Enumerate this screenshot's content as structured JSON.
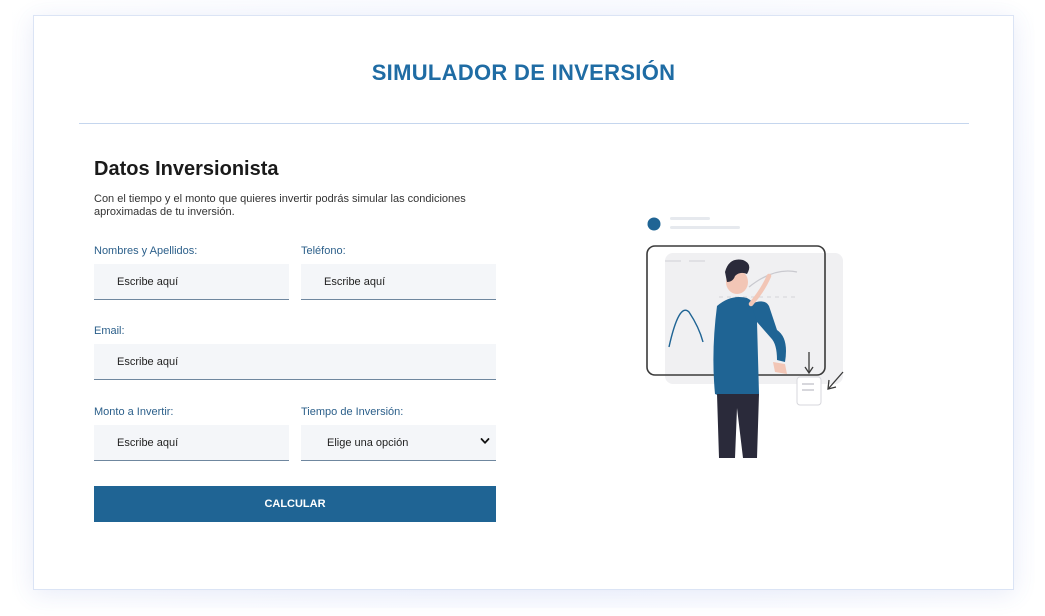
{
  "header": {
    "title": "SIMULADOR DE INVERSIÓN"
  },
  "form": {
    "section_title": "Datos Inversionista",
    "description": "Con el tiempo y el monto que quieres invertir podrás simular las condiciones aproximadas de tu inversión.",
    "fields": {
      "name": {
        "label": "Nombres y Apellidos:",
        "placeholder": "Escribe aquí"
      },
      "phone": {
        "label": "Teléfono:",
        "placeholder": "Escribe aquí"
      },
      "email": {
        "label": "Email:",
        "placeholder": "Escribe aquí"
      },
      "amount": {
        "label": "Monto a Invertir:",
        "placeholder": "Escribe aquí"
      },
      "term": {
        "label": "Tiempo de Inversión:",
        "selected": "Elige una opción"
      }
    },
    "submit_label": "CALCULAR"
  },
  "illustration": {
    "icon": "investor-chart-illustration"
  },
  "colors": {
    "accent": "#1f6ca4",
    "button": "#1f6494",
    "label": "#2b5f8a",
    "input_bg": "#f4f6f9"
  }
}
